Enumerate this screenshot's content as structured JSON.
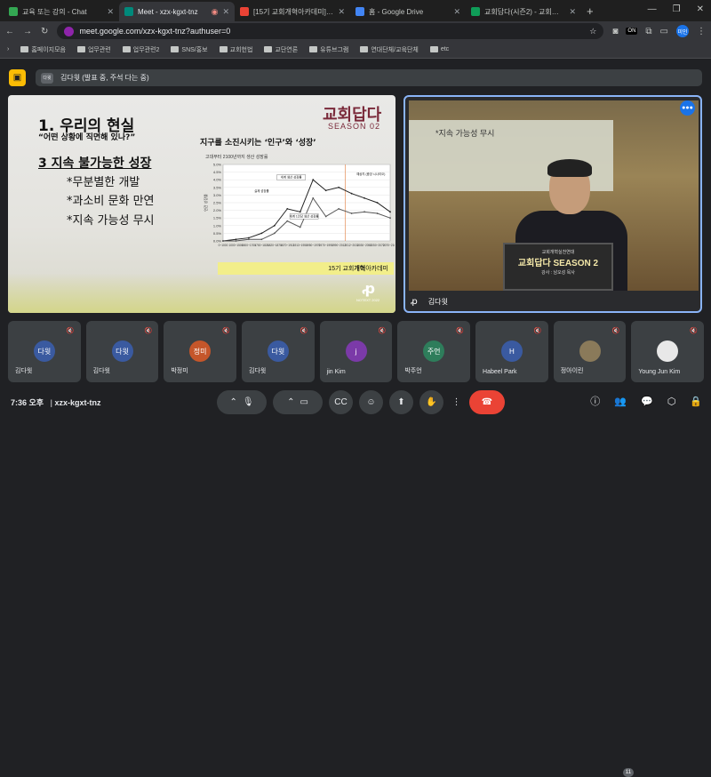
{
  "browser": {
    "tabs": [
      {
        "title": "교육 또는 강의 - Chat",
        "color": "#34a853"
      },
      {
        "title": "Meet - xzx-kgxt-tnz",
        "color": "#00897b"
      },
      {
        "title": "[15기 교회개혁아카데미] '1.공",
        "color": "#ea4335"
      },
      {
        "title": "홈 - Google Drive",
        "color": "#4285f4"
      },
      {
        "title": "교회답다(시즌2) - 교회다운 교",
        "color": "#0f9d58"
      }
    ],
    "new_tab": "+",
    "url": "meet.google.com/xzx-kgxt-tnz?authuser=0",
    "on_badge": "ON",
    "profile": "미인"
  },
  "bookmarks": [
    "홈페이지모음",
    "업무관련",
    "업무관련2",
    "SNS/홍보",
    "교회헌법",
    "교단연론",
    "유튜브그램",
    "연대단체/교육단체",
    "etc"
  ],
  "presenter": {
    "label": "김다윗 (발표 중, 주석 다는 중)",
    "mini": "다윗"
  },
  "slide": {
    "heading": "1. 우리의 현실",
    "question": "“어떤 상황에 직면해 있나?”",
    "subheading": "3 지속 불가능한 성장",
    "items": [
      "*무분별한 개발",
      "*과소비 문화 만연",
      "*지속 가능성 무시"
    ],
    "logo": "교회답다",
    "season": "SEASON 02",
    "chart_title": "지구를 소진시키는 ‘인구’와 ‘성장’",
    "chart_subtitle": "고대부터 2100년까지 생산 성장률",
    "footer_pre": "15기 교회",
    "footer_bold": "개혁",
    "footer_post": "아카데미",
    "mark": "ꝓ",
    "mark_sub": "NOTEXT 2022"
  },
  "chart_data": {
    "type": "line",
    "title": "지구를 소진시키는 ‘인구’와 ‘성장’",
    "subtitle": "고대부터 2100년까지 생산 성장률",
    "ylabel": "연간 성장률",
    "x": [
      "0~1000",
      "1000~1500",
      "1500~1700",
      "1700~1820",
      "1820~1870",
      "1870~1913",
      "1913~1950",
      "1950~1970",
      "1970~1990",
      "1990~2012",
      "2012~2030",
      "2030~2050",
      "2050~2070",
      "2070~2100"
    ],
    "series": [
      {
        "name": "세계 생산 성장률",
        "values": [
          0.0,
          0.1,
          0.2,
          0.5,
          1.0,
          2.1,
          1.9,
          4.0,
          3.3,
          3.5,
          3.1,
          2.8,
          2.5,
          1.9
        ]
      },
      {
        "name": "세계 1인당 생산 성장률",
        "values": [
          0.0,
          0.0,
          0.1,
          0.1,
          0.5,
          1.3,
          0.9,
          2.8,
          1.6,
          2.1,
          1.8,
          1.9,
          1.8,
          1.5
        ]
      }
    ],
    "annotations": [
      "실제 성장률",
      "예상치 (중앙 시나리오)"
    ],
    "yticks": [
      "0.0%",
      "0.5%",
      "1.0%",
      "1.5%",
      "2.0%",
      "2.5%",
      "3.0%",
      "3.5%",
      "4.0%",
      "4.5%",
      "5.0%"
    ],
    "ylim": [
      0,
      5
    ]
  },
  "speaker": {
    "screen_text": "*지속 가능성 무시",
    "podium_line1": "교회개혁실천연대",
    "podium_line2": "교회답다 SEASON 2",
    "podium_line3": "강사 : 남오성 목사",
    "name": "김다윗",
    "audio": "●●●"
  },
  "participants": [
    {
      "initials": "다윗",
      "name": "김다윗",
      "color": "#3a5aa0"
    },
    {
      "initials": "다윗",
      "name": "김다윗",
      "color": "#3a5aa0"
    },
    {
      "initials": "정미",
      "name": "박정미",
      "color": "#c5562a"
    },
    {
      "initials": "다윗",
      "name": "김다윗",
      "color": "#3a5aa0"
    },
    {
      "initials": "j",
      "name": "jin Kim",
      "color": "#7b3aa8"
    },
    {
      "initials": "주언",
      "name": "박주언",
      "color": "#2e7d5b"
    },
    {
      "initials": "H",
      "name": "Habeel Park",
      "color": "#3a5aa0"
    },
    {
      "initials": "",
      "name": "정아이린",
      "color": "#8a7a5a"
    },
    {
      "initials": "",
      "name": "Young Jun Kim",
      "color": "#e8e8e8"
    }
  ],
  "bottom": {
    "time": "7:36 오후",
    "meeting_code": "xzx-kgxt-tnz",
    "participant_count": "11"
  }
}
